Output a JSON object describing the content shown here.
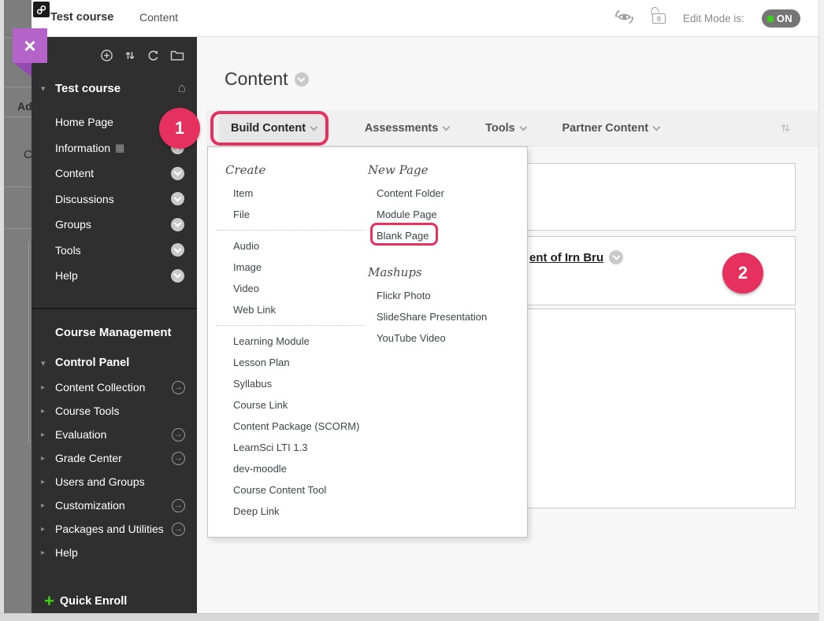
{
  "topbar": {
    "breadcrumb_course": "Test course",
    "breadcrumb_page": "Content",
    "lock_count": "0",
    "edit_mode_label": "Edit Mode is:",
    "edit_mode_value": "ON"
  },
  "overlay": {
    "close_icon": "×",
    "underlay_fragments": [
      "Ad",
      "C"
    ]
  },
  "sidebar": {
    "course_title": "Test course",
    "collapse_icon": "▾",
    "home_icon": "⌂",
    "grid_icon": "▦",
    "menu": [
      {
        "label": "Home Page"
      },
      {
        "label": "Information"
      },
      {
        "label": "Content"
      },
      {
        "label": "Discussions"
      },
      {
        "label": "Groups"
      },
      {
        "label": "Tools"
      },
      {
        "label": "Help"
      }
    ],
    "management_title": "Course Management",
    "control_panel_label": "Control Panel",
    "expand_icon": "▸",
    "arrow_icon": "→",
    "control_panel_items": [
      {
        "label": "Content Collection",
        "arrow": true
      },
      {
        "label": "Course Tools",
        "arrow": false
      },
      {
        "label": "Evaluation",
        "arrow": true
      },
      {
        "label": "Grade Center",
        "arrow": true
      },
      {
        "label": "Users and Groups",
        "arrow": false
      },
      {
        "label": "Customization",
        "arrow": true
      },
      {
        "label": "Packages and Utilities",
        "arrow": true
      },
      {
        "label": "Help",
        "arrow": false
      }
    ],
    "quick_enroll_plus": "+",
    "quick_enroll_label": "Quick Enroll"
  },
  "main": {
    "page_title": "Content",
    "action_buttons": [
      {
        "label": "Build Content"
      },
      {
        "label": "Assessments"
      },
      {
        "label": "Tools"
      },
      {
        "label": "Partner Content"
      }
    ],
    "dropdown": {
      "create_header": "Create",
      "create_group1": [
        "Item",
        "File"
      ],
      "create_group2": [
        "Audio",
        "Image",
        "Video",
        "Web Link"
      ],
      "create_group3": [
        "Learning Module",
        "Lesson Plan",
        "Syllabus",
        "Course Link",
        "Content Package (SCORM)",
        "LearnSci LTI 1.3",
        "dev-moodle",
        "Course Content Tool",
        "Deep Link"
      ],
      "new_page_header": "New Page",
      "new_page_items": [
        "Content Folder",
        "Module Page",
        "Blank Page"
      ],
      "mashups_header": "Mashups",
      "mashups_items": [
        "Flickr Photo",
        "SlideShare Presentation",
        "YouTube Video"
      ]
    },
    "content_item_fragment": "ent of Irn Bru"
  },
  "annotations": {
    "step1": "1",
    "step2": "2"
  },
  "colors": {
    "highlight_pink": "#e6315f",
    "close_purple": "#b464c8",
    "close_fold_purple": "#9349ae",
    "edit_on_green": "#3ecb1e",
    "quick_enroll_green": "#3fd411",
    "sidebar_bg": "#2f2f2f",
    "main_bg": "#f7f7f7"
  }
}
